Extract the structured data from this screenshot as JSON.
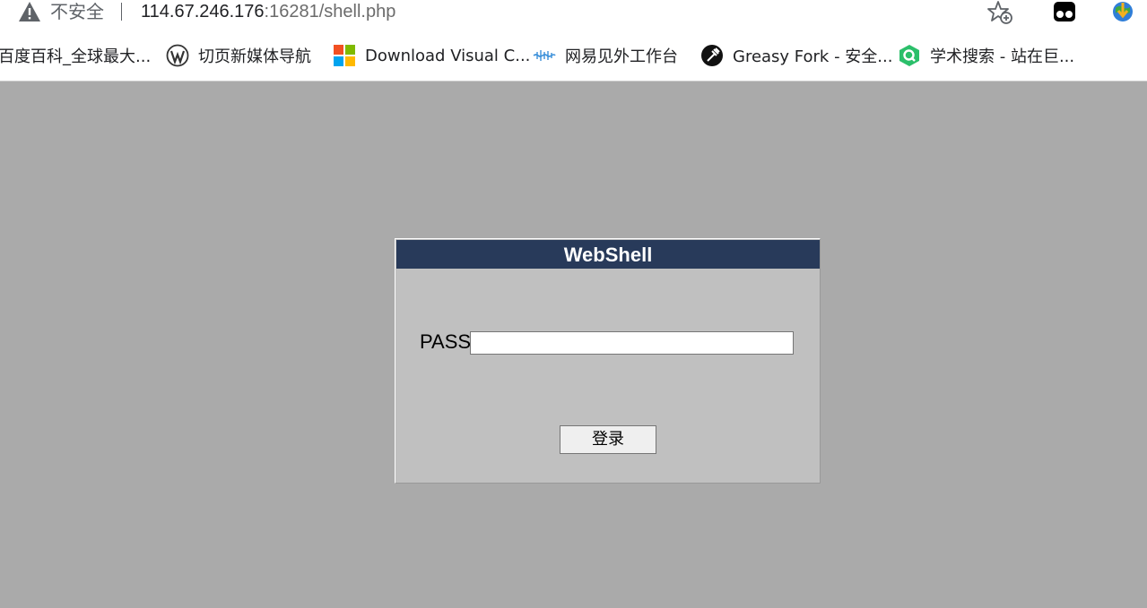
{
  "address_bar": {
    "security_label": "不安全",
    "url_host": "114.67.246.176",
    "url_rest": ":16281/shell.php"
  },
  "bookmarks": [
    {
      "label": "百度百科_全球最大...",
      "icon": "baidu-baike-icon"
    },
    {
      "label": "切页新媒体导航",
      "icon": "wordpress-icon"
    },
    {
      "label": "Download Visual C...",
      "icon": "microsoft-icon"
    },
    {
      "label": "网易见外工作台",
      "icon": "netease-jianwai-icon"
    },
    {
      "label": "Greasy Fork - 安全...",
      "icon": "greasy-fork-icon"
    },
    {
      "label": "学术搜索 - 站在巨...",
      "icon": "scholar-search-icon"
    }
  ],
  "login": {
    "title": "WebShell",
    "pass_label": "PASS:",
    "pass_value": "",
    "submit_label": "登录"
  },
  "colors": {
    "page_bg": "#aaaaaa",
    "box_bg": "#c0c0c0",
    "header_bg": "#283a5a",
    "header_text": "#ffffff"
  }
}
